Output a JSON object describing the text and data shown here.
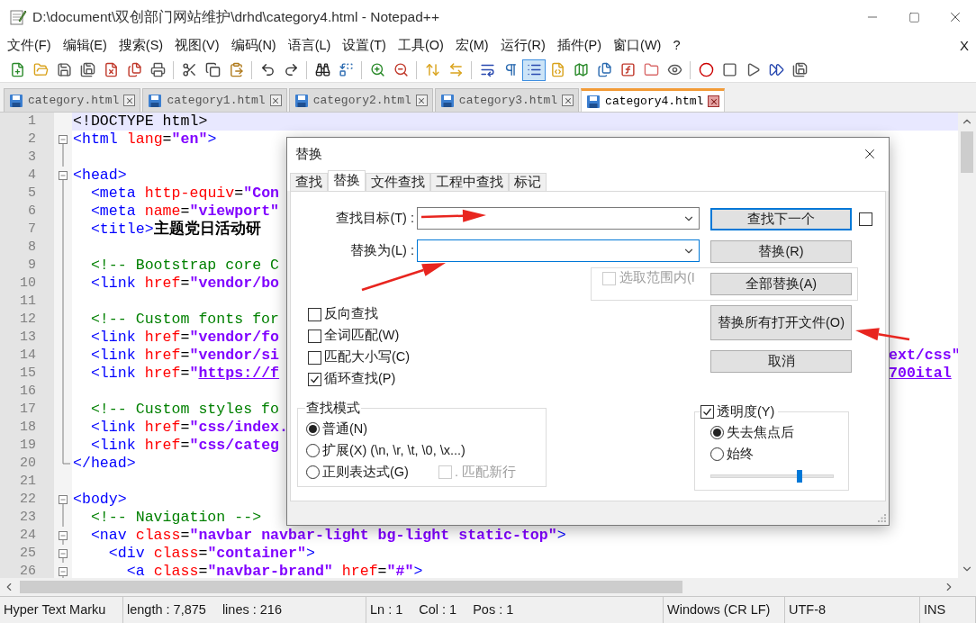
{
  "window": {
    "title": "D:\\document\\双创部门网站维护\\drhd\\category4.html - Notepad++"
  },
  "menu": [
    "文件(F)",
    "编辑(E)",
    "搜索(S)",
    "视图(V)",
    "编码(N)",
    "语言(L)",
    "设置(T)",
    "工具(O)",
    "宏(M)",
    "运行(R)",
    "插件(P)",
    "窗口(W)",
    "?"
  ],
  "menu_close": "X",
  "toolbar": [
    [
      {
        "pressed": false
      },
      {
        "pressed": false
      },
      {
        "pressed": false
      },
      {
        "pressed": false
      },
      {
        "pressed": false
      },
      {
        "pressed": false
      },
      {
        "pressed": false
      }
    ],
    [
      {
        "pressed": false
      },
      {
        "pressed": false
      },
      {
        "pressed": false
      }
    ],
    [
      {
        "pressed": false
      },
      {
        "pressed": false
      }
    ],
    [
      {
        "pressed": false
      },
      {
        "pressed": false
      }
    ],
    [
      {
        "pressed": false
      },
      {
        "pressed": false
      }
    ],
    [
      {
        "pressed": false
      },
      {
        "pressed": false
      }
    ],
    [
      {
        "pressed": false
      },
      {
        "pressed": false
      },
      {
        "pressed": true
      },
      {
        "pressed": false
      },
      {
        "pressed": false
      },
      {
        "pressed": false
      },
      {
        "pressed": false
      },
      {
        "pressed": false
      },
      {
        "pressed": false
      }
    ],
    [
      {
        "pressed": false
      },
      {
        "pressed": false
      },
      {
        "pressed": false
      },
      {
        "pressed": false
      },
      {
        "pressed": false
      }
    ]
  ],
  "file_tabs": [
    {
      "label": "category.html",
      "selected": false
    },
    {
      "label": "category1.html",
      "selected": false
    },
    {
      "label": "category2.html",
      "selected": false
    },
    {
      "label": "category3.html",
      "selected": false
    },
    {
      "label": "category4.html",
      "selected": true
    }
  ],
  "lines": [
    {
      "number": "1",
      "current": true,
      "kind": "plain",
      "tokens": [
        {
          "kind": "plain",
          "text": "<!DOCTYPE html>"
        }
      ]
    },
    {
      "number": "2",
      "current": false,
      "kind": "start",
      "tokens": [
        {
          "kind": "tag",
          "text": "<html"
        },
        {
          "kind": "attr",
          "text": " lang"
        },
        {
          "kind": "op",
          "text": "="
        },
        {
          "kind": "value",
          "text": "\"en\""
        },
        {
          "kind": "tag",
          "text": ">"
        }
      ]
    },
    {
      "number": "3",
      "current": false,
      "kind": "inner"
    },
    {
      "number": "4",
      "current": false,
      "kind": "start",
      "tokens": [
        {
          "kind": "tag",
          "text": "<head>"
        }
      ]
    },
    {
      "number": "5",
      "current": false,
      "kind": "inner",
      "tokens": [
        {
          "kind": "tag",
          "text": "  <meta"
        },
        {
          "kind": "attr",
          "text": " http-equiv"
        },
        {
          "kind": "op",
          "text": "="
        },
        {
          "kind": "value",
          "text": "\"Con"
        }
      ]
    },
    {
      "number": "6",
      "current": false,
      "kind": "inner",
      "tokens": [
        {
          "kind": "tag",
          "text": "  <meta"
        },
        {
          "kind": "attr",
          "text": " name"
        },
        {
          "kind": "op",
          "text": "="
        },
        {
          "kind": "value",
          "text": "\"viewport\""
        }
      ]
    },
    {
      "number": "7",
      "current": false,
      "kind": "inner",
      "tokens": [
        {
          "kind": "tag",
          "text": "  <title>"
        },
        {
          "kind": "text",
          "text": "主题党日活动研"
        }
      ]
    },
    {
      "number": "8",
      "current": false,
      "kind": "inner"
    },
    {
      "number": "9",
      "current": false,
      "kind": "inner",
      "tokens": [
        {
          "kind": "comment",
          "text": "  <!-- Bootstrap core C"
        }
      ]
    },
    {
      "number": "10",
      "current": false,
      "kind": "inner",
      "tokens": [
        {
          "kind": "tag",
          "text": "  <link"
        },
        {
          "kind": "attr",
          "text": " href"
        },
        {
          "kind": "op",
          "text": "="
        },
        {
          "kind": "value",
          "text": "\"vendor/bo"
        }
      ]
    },
    {
      "number": "11",
      "current": false,
      "kind": "inner"
    },
    {
      "number": "12",
      "current": false,
      "kind": "inner",
      "tokens": [
        {
          "kind": "comment",
          "text": "  <!-- Custom fonts for"
        }
      ]
    },
    {
      "number": "13",
      "current": false,
      "kind": "inner",
      "tokens": [
        {
          "kind": "tag",
          "text": "  <link"
        },
        {
          "kind": "attr",
          "text": " href"
        },
        {
          "kind": "op",
          "text": "="
        },
        {
          "kind": "value",
          "text": "\"vendor/fo"
        }
      ]
    },
    {
      "number": "14",
      "current": false,
      "kind": "inner",
      "tokens": [
        {
          "kind": "tag",
          "text": "  <link"
        },
        {
          "kind": "attr",
          "text": " href"
        },
        {
          "kind": "op",
          "text": "="
        },
        {
          "kind": "value",
          "text": "\"vendor/si"
        }
      ],
      "right": [
        {
          "kind": "value",
          "text": "ext/css\""
        }
      ]
    },
    {
      "number": "15",
      "current": false,
      "kind": "inner",
      "tokens": [
        {
          "kind": "tag",
          "text": "  <link"
        },
        {
          "kind": "attr",
          "text": " href"
        },
        {
          "kind": "op",
          "text": "="
        },
        {
          "kind": "value",
          "text": "\""
        },
        {
          "kind": "link",
          "text": "https://f"
        }
      ],
      "right": [
        {
          "kind": "link",
          "text": "700ital"
        }
      ]
    },
    {
      "number": "16",
      "current": false,
      "kind": "inner"
    },
    {
      "number": "17",
      "current": false,
      "kind": "inner",
      "tokens": [
        {
          "kind": "comment",
          "text": "  <!-- Custom styles fo"
        }
      ]
    },
    {
      "number": "18",
      "current": false,
      "kind": "inner",
      "tokens": [
        {
          "kind": "tag",
          "text": "  <link"
        },
        {
          "kind": "attr",
          "text": " href"
        },
        {
          "kind": "op",
          "text": "="
        },
        {
          "kind": "value",
          "text": "\"css/index."
        }
      ]
    },
    {
      "number": "19",
      "current": false,
      "kind": "inner",
      "tokens": [
        {
          "kind": "tag",
          "text": "  <link"
        },
        {
          "kind": "attr",
          "text": " href"
        },
        {
          "kind": "op",
          "text": "="
        },
        {
          "kind": "value",
          "text": "\"css/categ"
        }
      ]
    },
    {
      "number": "20",
      "current": false,
      "kind": "end",
      "tokens": [
        {
          "kind": "tag",
          "text": "</head>"
        }
      ]
    },
    {
      "number": "21",
      "current": false,
      "kind": "plain"
    },
    {
      "number": "22",
      "current": false,
      "kind": "start",
      "tokens": [
        {
          "kind": "tag",
          "text": "<body>"
        }
      ]
    },
    {
      "number": "23",
      "current": false,
      "kind": "inner",
      "tokens": [
        {
          "kind": "comment",
          "text": "  <!-- Navigation -->"
        }
      ]
    },
    {
      "number": "24",
      "current": false,
      "kind": "start",
      "tokens": [
        {
          "kind": "tag",
          "text": "  <nav"
        },
        {
          "kind": "attr",
          "text": " class"
        },
        {
          "kind": "op",
          "text": "="
        },
        {
          "kind": "value",
          "text": "\"navbar navbar-light bg-light static-top\""
        },
        {
          "kind": "tag",
          "text": ">"
        }
      ]
    },
    {
      "number": "25",
      "current": false,
      "kind": "start",
      "tokens": [
        {
          "kind": "tag",
          "text": "    <div"
        },
        {
          "kind": "attr",
          "text": " class"
        },
        {
          "kind": "op",
          "text": "="
        },
        {
          "kind": "value",
          "text": "\"container\""
        },
        {
          "kind": "tag",
          "text": ">"
        }
      ]
    },
    {
      "number": "26",
      "current": false,
      "kind": "start",
      "tokens": [
        {
          "kind": "tag",
          "text": "      <a"
        },
        {
          "kind": "attr",
          "text": " class"
        },
        {
          "kind": "op",
          "text": "="
        },
        {
          "kind": "value",
          "text": "\"navbar-brand\""
        },
        {
          "kind": "attr",
          "text": " href"
        },
        {
          "kind": "op",
          "text": "="
        },
        {
          "kind": "value",
          "text": "\"#\""
        },
        {
          "kind": "tag",
          "text": ">"
        }
      ]
    }
  ],
  "dialog": {
    "title": "替换",
    "tabs": [
      {
        "label": "查找",
        "selected": false
      },
      {
        "label": "替换",
        "selected": true
      },
      {
        "label": "文件查找",
        "selected": false
      },
      {
        "label": "工程中查找",
        "selected": false
      },
      {
        "label": "标记",
        "selected": false
      }
    ],
    "fields": [
      {
        "label": "查找目标(T) :",
        "focused": false
      },
      {
        "label": "替换为(L) :",
        "focused": true
      }
    ],
    "buttons": [
      {
        "label": "查找下一个",
        "kind": "normal",
        "focused": true
      },
      {
        "label": "替换(R)",
        "kind": "normal",
        "focused": false
      },
      {
        "label": "全部替换(A)",
        "kind": "normal",
        "focused": false
      },
      {
        "label": "替换所有打开文件(O)",
        "kind": "tall",
        "focused": false
      },
      {
        "label": "取消",
        "kind": "normal",
        "focused": false
      }
    ],
    "side_checkbox": {
      "checked": false
    },
    "in_selection": {
      "label": "选取范围内(I",
      "checked": false,
      "disabled": true
    },
    "options": [
      {
        "label": "反向查找",
        "checked": false
      },
      {
        "label": "全词匹配(W)",
        "checked": false
      },
      {
        "label": "匹配大小写(C)",
        "checked": false
      },
      {
        "label": "循环查找(P)",
        "checked": true
      }
    ],
    "search_mode": {
      "title": "查找模式",
      "options": [
        {
          "label": "普通(N)",
          "selected": true
        },
        {
          "label": "扩展(X) (\\n, \\r, \\t, \\0, \\x...)",
          "selected": false
        },
        {
          "label": "正则表达式(G)",
          "selected": false
        }
      ],
      "newline": {
        "label": ". 匹配新行",
        "checked": false,
        "disabled": true
      }
    },
    "transparency": {
      "label": "透明度(Y)",
      "checked": true,
      "options": [
        {
          "label": "失去焦点后",
          "selected": true
        },
        {
          "label": "始终",
          "selected": false
        }
      ],
      "level": 0.72
    }
  },
  "status_bar": [
    {
      "texts": [
        "Hyper Text Marku"
      ]
    },
    {
      "texts": [
        "length : 7,875",
        "lines : 216"
      ]
    },
    {
      "texts": [
        "Ln : 1",
        "Col : 1",
        "Pos : 1"
      ]
    },
    {
      "texts": [
        "Windows (CR LF)"
      ]
    },
    {
      "texts": [
        "UTF-8"
      ]
    },
    {
      "texts": [
        "INS"
      ]
    }
  ]
}
